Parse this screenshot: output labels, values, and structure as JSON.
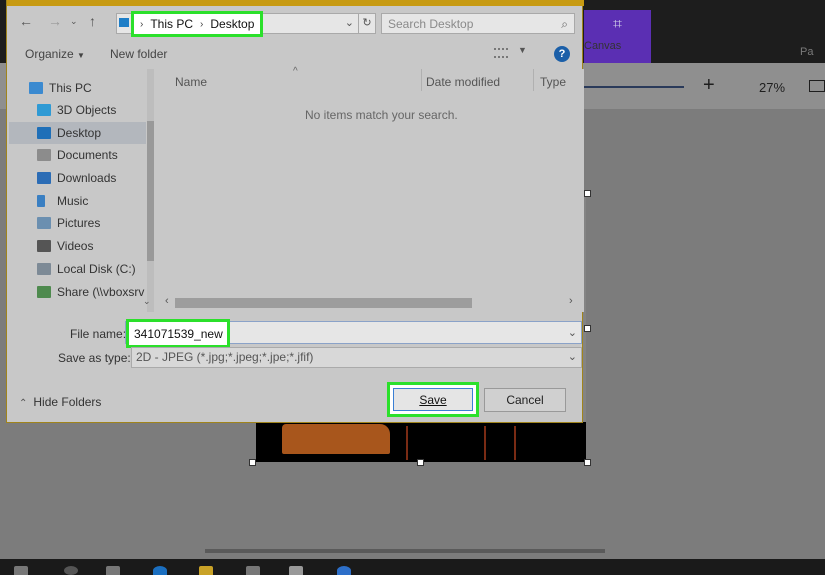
{
  "background_app": {
    "canvas_tab_label": "Canvas",
    "next_tab_partial": "Pa",
    "zoom_plus": "+",
    "zoom_value": "27%"
  },
  "dialog": {
    "breadcrumb": [
      "This PC",
      "Desktop"
    ],
    "search_placeholder": "Search Desktop",
    "toolbar": {
      "organize": "Organize",
      "new_folder": "New folder",
      "help": "?"
    },
    "nav_tree": [
      {
        "label": "This PC",
        "icon": "pc-icon"
      },
      {
        "label": "3D Objects",
        "icon": "3d-objects-icon"
      },
      {
        "label": "Desktop",
        "icon": "desktop-icon",
        "selected": true
      },
      {
        "label": "Documents",
        "icon": "documents-icon"
      },
      {
        "label": "Downloads",
        "icon": "downloads-icon"
      },
      {
        "label": "Music",
        "icon": "music-icon"
      },
      {
        "label": "Pictures",
        "icon": "pictures-icon"
      },
      {
        "label": "Videos",
        "icon": "videos-icon"
      },
      {
        "label": "Local Disk (C:)",
        "icon": "disk-icon"
      },
      {
        "label": "Share (\\\\vboxsrv",
        "icon": "network-drive-icon"
      }
    ],
    "columns": [
      "Name",
      "Date modified",
      "Type"
    ],
    "empty_message": "No items match your search.",
    "file_name_label": "File name:",
    "file_name_value": "341071539_new",
    "save_as_type_label": "Save as type:",
    "save_as_type_value": "2D - JPEG (*.jpg;*.jpeg;*.jpe;*.jfif)",
    "hide_folders": "Hide Folders",
    "save_button": "Save",
    "cancel_button": "Cancel"
  },
  "colors": {
    "highlight": "#2be02b",
    "dialog_accent": "#c79a12",
    "canvas_tab": "#5b2fb3"
  }
}
